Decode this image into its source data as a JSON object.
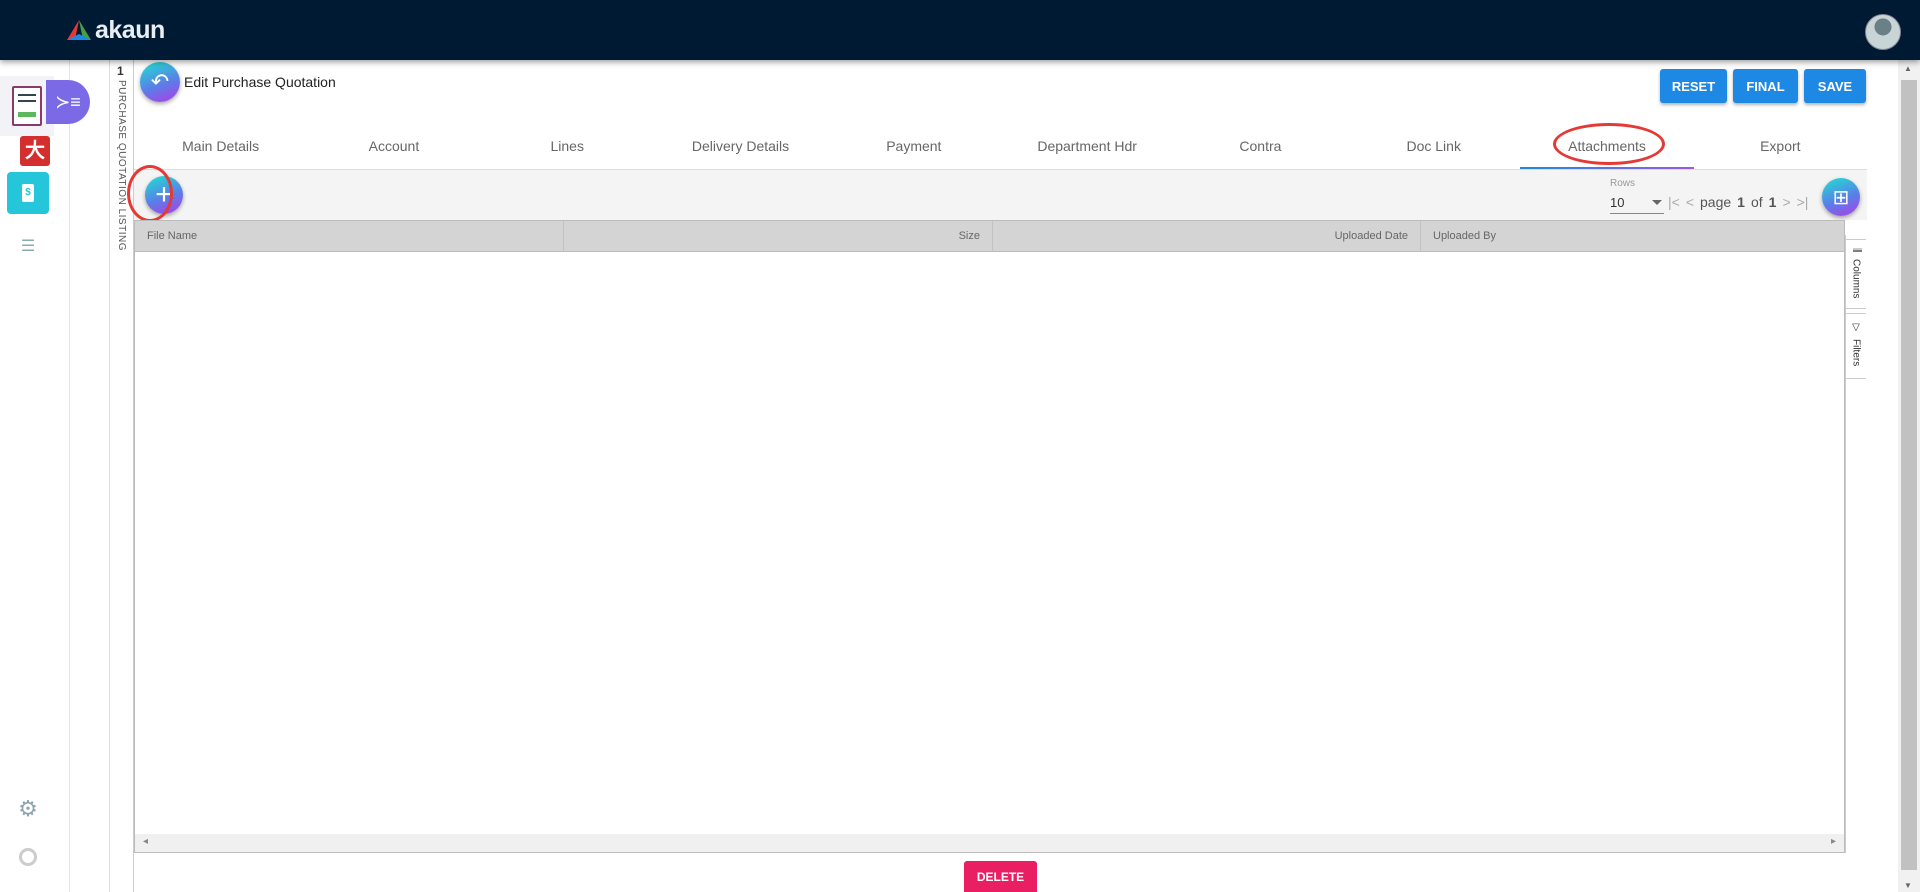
{
  "app": {
    "brand": "akaun"
  },
  "page": {
    "title": "Edit Purchase Quotation",
    "listing_count": "1",
    "listing_label": "PURCHASE QUOTATION LISTING"
  },
  "actions": {
    "reset": "RESET",
    "final": "FINAL",
    "save": "SAVE",
    "delete": "DELETE"
  },
  "tabs": [
    {
      "label": "Main Details"
    },
    {
      "label": "Account"
    },
    {
      "label": "Lines"
    },
    {
      "label": "Delivery Details"
    },
    {
      "label": "Payment"
    },
    {
      "label": "Department Hdr"
    },
    {
      "label": "Contra"
    },
    {
      "label": "Doc Link"
    },
    {
      "label": "Attachments",
      "active": true
    },
    {
      "label": "Export"
    }
  ],
  "pagination": {
    "rows_label": "Rows",
    "rows_value": "10",
    "page_word": "page",
    "page": "1",
    "of_word": "of",
    "total": "1"
  },
  "grid": {
    "columns": [
      "File Name",
      "Size",
      "Uploaded Date",
      "Uploaded By"
    ],
    "rows": [],
    "side_panels": [
      "Columns",
      "Filters"
    ]
  },
  "colors": {
    "header": "#001a33",
    "primary": "#1e88e5",
    "danger": "#e91e63",
    "highlight": "#e53935"
  }
}
